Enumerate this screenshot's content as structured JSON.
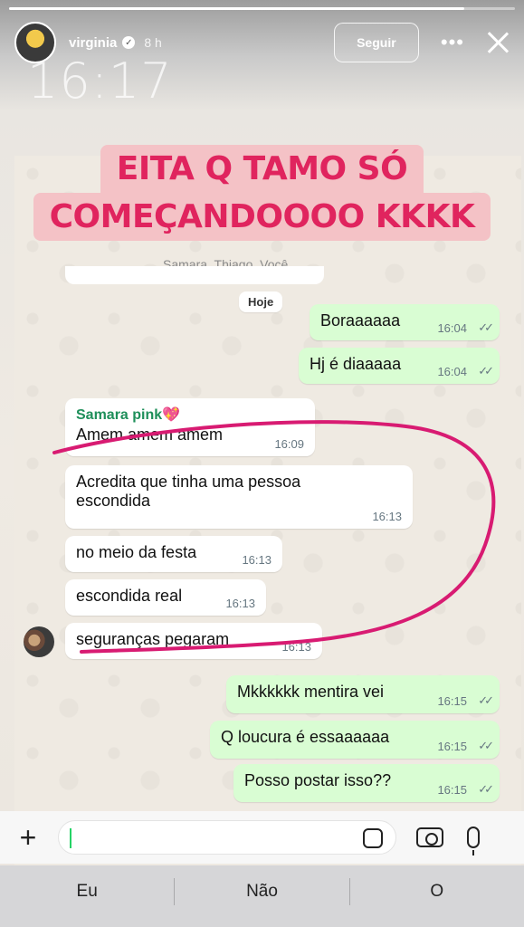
{
  "story": {
    "progress_fraction": 0.9,
    "username": "virginia",
    "age": "8 h",
    "follow_label": "Seguir",
    "clock": "16:17",
    "caption": [
      "EITA Q TAMO SÓ",
      "COMEÇANDOOOO KKKK"
    ],
    "icons": {
      "more": "more-icon",
      "close": "close-icon",
      "verified": "verified-icon"
    }
  },
  "chat": {
    "members": "Samara, Thiago, Você",
    "day_chip": "Hoje",
    "messages": [
      {
        "dir": "out",
        "text": "Boraaaaaa",
        "time": "16:04"
      },
      {
        "dir": "out",
        "text": "Hj é diaaaaa",
        "time": "16:04"
      },
      {
        "dir": "in",
        "sender": "Samara pink💖",
        "text": "Amem amem amem",
        "time": "16:09"
      },
      {
        "dir": "in",
        "text": "Acredita que tinha uma pessoa escondida",
        "time": "16:13"
      },
      {
        "dir": "in",
        "text": "no meio da festa",
        "time": "16:13"
      },
      {
        "dir": "in",
        "text": "escondida real",
        "time": "16:13"
      },
      {
        "dir": "in",
        "text": "seguranças pegaram",
        "time": "16:13"
      },
      {
        "dir": "out",
        "text": "Mkkkkkk mentira vei",
        "time": "16:15"
      },
      {
        "dir": "out",
        "text": "Q loucura é essaaaaaa",
        "time": "16:15"
      },
      {
        "dir": "out",
        "text": "Posso postar isso??",
        "time": "16:15"
      }
    ],
    "ticks": "✓✓",
    "accent_colors": {
      "incoming": "#ffffff",
      "outgoing": "#d9fdd3",
      "sender_name": "#1e8f5a",
      "caption_text": "#e0245e",
      "caption_bg": "#f4c2c6",
      "annotation_stroke": "#d81b72"
    }
  },
  "keyboard": {
    "suggestions": [
      "Eu",
      "Não",
      "O"
    ]
  }
}
